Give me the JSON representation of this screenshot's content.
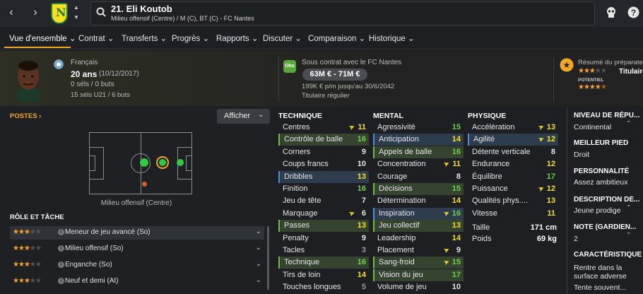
{
  "header": {
    "player_title": "21. Eli Koutob",
    "player_desc": "Milieu offensif (Centre) / M (C), BT (C) - FC Nantes"
  },
  "tabs": [
    {
      "label": "Vue d'ensemble"
    },
    {
      "label": "Contrat"
    },
    {
      "label": "Transferts"
    },
    {
      "label": "Progrès"
    },
    {
      "label": "Rapports"
    },
    {
      "label": "Discuter"
    },
    {
      "label": "Comparaison"
    },
    {
      "label": "Historique"
    }
  ],
  "info": {
    "nationality": "Français",
    "age": "20 ans",
    "dob": "(10/12/2017)",
    "caps": "0 séls / 0 buts",
    "u21": "15 séls U21 / 6 buts",
    "contract_badge": "Obs",
    "contract_club": "Sous contrat avec le FC Nantes",
    "value": "63M € - 71M €",
    "wage": "199K € p/m jusqu'au 30/6/2042",
    "status": "Titulaire régulier",
    "scout_title": "Résumé du préparateur",
    "scout_role": "Titulaire",
    "potential_label": "POTENTIEL",
    "current_stars": 3,
    "potential_stars": 4.5
  },
  "positions": {
    "title": "POSTES",
    "show_button": "Afficher",
    "position_caption": "Milieu offensif (Centre)"
  },
  "roles": {
    "title": "RÔLE ET TÂCHE",
    "items": [
      {
        "name": "Meneur de jeu avancé (So)",
        "stars": 3
      },
      {
        "name": "Milieu offensif (So)",
        "stars": 3
      },
      {
        "name": "Enganche (So)",
        "stars": 3
      },
      {
        "name": "Neuf et demi (At)",
        "stars": 3
      }
    ]
  },
  "technique": {
    "title": "TECHNIQUE",
    "rows": [
      {
        "name": "Centres",
        "value": "11",
        "color": "#f5e11d",
        "flag": true,
        "hl": ""
      },
      {
        "name": "Contrôle de balle",
        "value": "16",
        "color": "#6dd34a",
        "flag": false,
        "hl": "green"
      },
      {
        "name": "Corners",
        "value": "9",
        "color": "#e6e6e6",
        "flag": false,
        "hl": ""
      },
      {
        "name": "Coups francs",
        "value": "10",
        "color": "#e6e6e6",
        "flag": false,
        "hl": ""
      },
      {
        "name": "Dribbles",
        "value": "13",
        "color": "#f5e11d",
        "flag": false,
        "hl": "blue"
      },
      {
        "name": "Finition",
        "value": "16",
        "color": "#6dd34a",
        "flag": false,
        "hl": ""
      },
      {
        "name": "Jeu de tête",
        "value": "7",
        "color": "#e6e6e6",
        "flag": false,
        "hl": ""
      },
      {
        "name": "Marquage",
        "value": "6",
        "color": "#e6e6e6",
        "flag": true,
        "hl": ""
      },
      {
        "name": "Passes",
        "value": "13",
        "color": "#f5e11d",
        "flag": false,
        "hl": "green"
      },
      {
        "name": "Penalty",
        "value": "9",
        "color": "#e6e6e6",
        "flag": false,
        "hl": ""
      },
      {
        "name": "Tacles",
        "value": "3",
        "color": "#9a9a9a",
        "flag": false,
        "hl": ""
      },
      {
        "name": "Technique",
        "value": "16",
        "color": "#6dd34a",
        "flag": false,
        "hl": "green"
      },
      {
        "name": "Tirs de loin",
        "value": "14",
        "color": "#f5e11d",
        "flag": false,
        "hl": ""
      },
      {
        "name": "Touches longues",
        "value": "5",
        "color": "#9a9a9a",
        "flag": false,
        "hl": ""
      }
    ]
  },
  "mental": {
    "title": "MENTAL",
    "rows": [
      {
        "name": "Agressivité",
        "value": "15",
        "color": "#6dd34a",
        "flag": false,
        "hl": ""
      },
      {
        "name": "Anticipation",
        "value": "14",
        "color": "#f5e11d",
        "flag": false,
        "hl": "blue"
      },
      {
        "name": "Appels de balle",
        "value": "16",
        "color": "#6dd34a",
        "flag": false,
        "hl": "green"
      },
      {
        "name": "Concentration",
        "value": "11",
        "color": "#f5e11d",
        "flag": true,
        "hl": ""
      },
      {
        "name": "Courage",
        "value": "8",
        "color": "#e6e6e6",
        "flag": false,
        "hl": ""
      },
      {
        "name": "Décisions",
        "value": "15",
        "color": "#6dd34a",
        "flag": false,
        "hl": "green"
      },
      {
        "name": "Détermination",
        "value": "14",
        "color": "#f5e11d",
        "flag": false,
        "hl": ""
      },
      {
        "name": "Inspiration",
        "value": "16",
        "color": "#6dd34a",
        "flag": true,
        "hl": "blue"
      },
      {
        "name": "Jeu collectif",
        "value": "13",
        "color": "#f5e11d",
        "flag": false,
        "hl": "green"
      },
      {
        "name": "Leadership",
        "value": "14",
        "color": "#f5e11d",
        "flag": false,
        "hl": ""
      },
      {
        "name": "Placement",
        "value": "9",
        "color": "#e6e6e6",
        "flag": true,
        "hl": ""
      },
      {
        "name": "Sang-froid",
        "value": "15",
        "color": "#6dd34a",
        "flag": true,
        "hl": "green"
      },
      {
        "name": "Vision du jeu",
        "value": "17",
        "color": "#6dd34a",
        "flag": false,
        "hl": "green"
      },
      {
        "name": "Volume de jeu",
        "value": "10",
        "color": "#e6e6e6",
        "flag": false,
        "hl": ""
      }
    ]
  },
  "physique": {
    "title": "PHYSIQUE",
    "rows": [
      {
        "name": "Accélération",
        "value": "13",
        "color": "#f5e11d",
        "flag": true,
        "hl": ""
      },
      {
        "name": "Agilité",
        "value": "12",
        "color": "#f5e11d",
        "flag": true,
        "hl": "blue"
      },
      {
        "name": "Détente verticale",
        "value": "8",
        "color": "#e6e6e6",
        "flag": false,
        "hl": ""
      },
      {
        "name": "Endurance",
        "value": "12",
        "color": "#f5e11d",
        "flag": false,
        "hl": ""
      },
      {
        "name": "Équilibre",
        "value": "17",
        "color": "#6dd34a",
        "flag": false,
        "hl": ""
      },
      {
        "name": "Puissance",
        "value": "12",
        "color": "#f5e11d",
        "flag": true,
        "hl": ""
      },
      {
        "name": "Qualités phys....",
        "value": "13",
        "color": "#f5e11d",
        "flag": false,
        "hl": ""
      },
      {
        "name": "Vitesse",
        "value": "11",
        "color": "#f5e11d",
        "flag": false,
        "hl": ""
      }
    ],
    "height_label": "Taille",
    "height_value": "171 cm",
    "weight_label": "Poids",
    "weight_value": "69 kg"
  },
  "right_panel": [
    {
      "label": "NIVEAU DE RÉPU...",
      "value": "Continental"
    },
    {
      "label": "MEILLEUR PIED",
      "value": "Droit"
    },
    {
      "label": "PERSONNALITÉ",
      "value": "Assez ambitieux"
    },
    {
      "label": "DESCRIPTION DE...",
      "value": "Jeune prodige"
    },
    {
      "label": "NOTE (GARDIEN...",
      "value": "2"
    },
    {
      "label": "CARACTÉRISTIQUE",
      "value": "Rentre dans la surface adverse",
      "value2": "Tente souvent..."
    }
  ],
  "colors": {
    "accent": "#f5a623",
    "good": "#6dd34a",
    "mid": "#f5e11d"
  }
}
